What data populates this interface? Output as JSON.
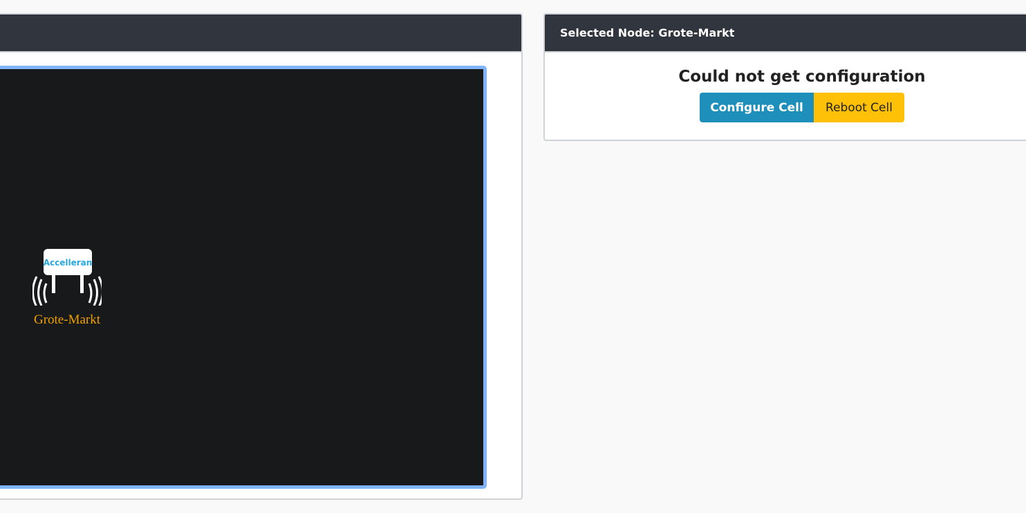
{
  "left_panel": {
    "header_title": ""
  },
  "graph": {
    "nodes": [
      {
        "label": "Grote-Markt",
        "logo_text": "Accelleran",
        "icon": "radio-cell-icon"
      }
    ]
  },
  "right_panel": {
    "header_title": "Selected Node: Grote-Markt",
    "message": "Could not get configuration",
    "configure_label": "Configure Cell",
    "reboot_label": "Reboot Cell"
  },
  "colors": {
    "primary": "#1e8fba",
    "warning": "#ffc107",
    "header": "#31353d",
    "canvas": "#18191b",
    "canvas_border": "#80b4fb",
    "node_label": "#f0a000"
  }
}
